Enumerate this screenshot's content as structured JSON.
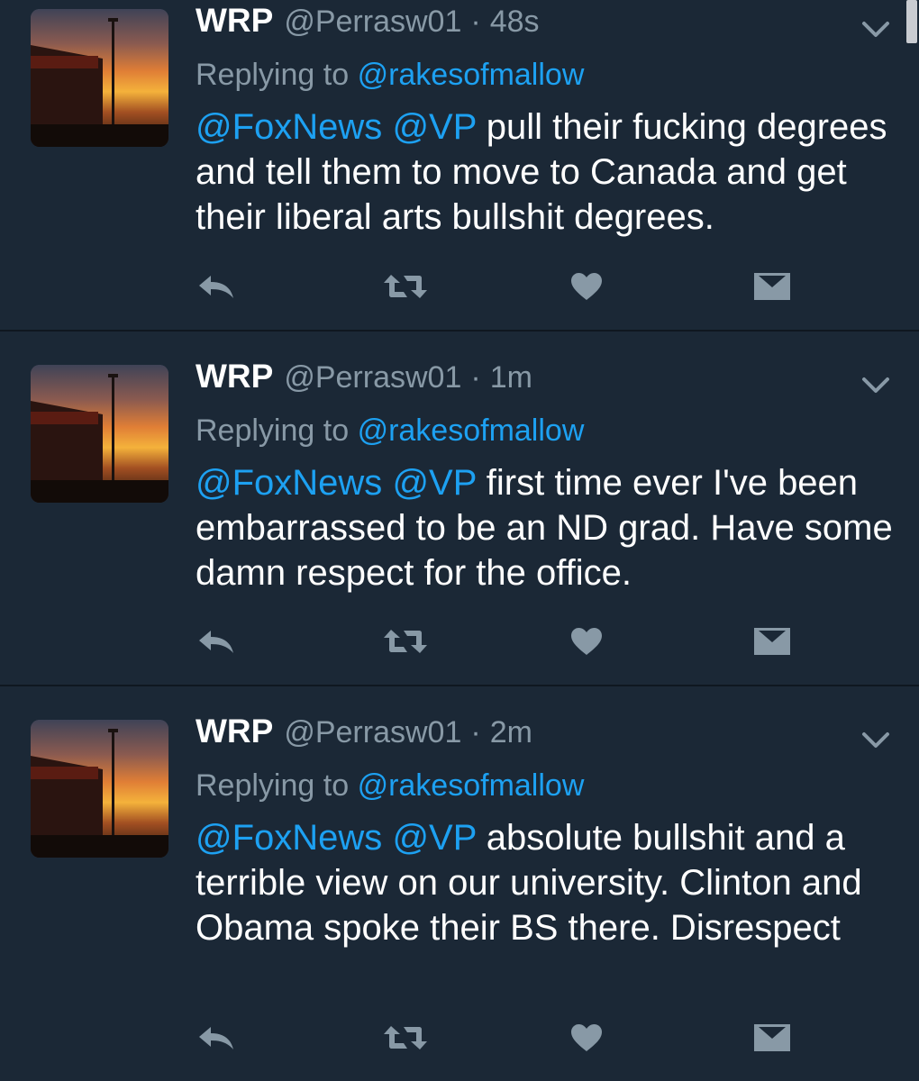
{
  "colors": {
    "background": "#1b2836",
    "muted": "#8899a6",
    "link": "#1da1f2",
    "text": "#ffffff"
  },
  "icons": {
    "reply": "reply-arrow-icon",
    "retweet": "retweet-icon",
    "like": "heart-icon",
    "dm": "envelope-icon",
    "menu": "chevron-down-icon"
  },
  "tweets": [
    {
      "name": "WRP",
      "handle": "@Perrasw01",
      "separator": "·",
      "time": "48s",
      "replying_prefix": "Replying to",
      "replying_to": "@rakesofmallow",
      "mention_1": "@FoxNews",
      "mention_2": "@VP",
      "body": " pull their fucking degrees and tell them to move to Canada and get their liberal arts bullshit degrees."
    },
    {
      "name": "WRP",
      "handle": "@Perrasw01",
      "separator": "·",
      "time": "1m",
      "replying_prefix": "Replying to",
      "replying_to": "@rakesofmallow",
      "mention_1": "@FoxNews",
      "mention_2": "@VP",
      "body": " first time ever I've been embarrassed to be an ND grad. Have some damn respect for the office."
    },
    {
      "name": "WRP",
      "handle": "@Perrasw01",
      "separator": "·",
      "time": "2m",
      "replying_prefix": "Replying to",
      "replying_to": "@rakesofmallow",
      "mention_1": "@FoxNews",
      "mention_2": "@VP",
      "body": " absolute bullshit and a terrible view on our university.  Clinton and Obama spoke their BS there. Disrespect"
    }
  ]
}
